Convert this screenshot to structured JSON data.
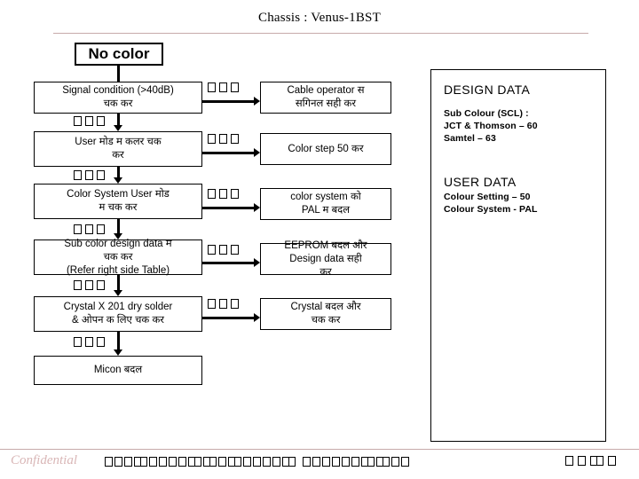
{
  "slide": {
    "title": "Chassis : Venus-1BST",
    "accent_rule_color": "#c7aaaa"
  },
  "flow": {
    "header_box": {
      "label": "No color"
    },
    "left_column": [
      {
        "id": "signal",
        "lines": [
          "Signal condition (>40dB)",
          "चक   कर"
        ]
      },
      {
        "id": "usermode",
        "lines": [
          "User मोड   म     कलर चक",
          "कर"
        ]
      },
      {
        "id": "colorsys",
        "lines": [
          "Color System  User मोड",
          "म     चक   कर"
        ]
      },
      {
        "id": "subcolor",
        "lines": [
          "Sub color design data म",
          "चक   कर",
          "(Refer right side Table)"
        ]
      },
      {
        "id": "crystal",
        "lines": [
          "Crystal  X 201   dry solder",
          "& ओपन  क   लिए   चक   कर"
        ]
      },
      {
        "id": "micon",
        "lines": [
          "Micon  बदल"
        ]
      }
    ],
    "right_column": [
      {
        "id": "cable",
        "lines": [
          "Cable operator स",
          "सगिनल    सही   कर"
        ]
      },
      {
        "id": "colorstep",
        "lines": [
          "Color step  50 कर"
        ]
      },
      {
        "id": "palchange",
        "lines": [
          "color system को",
          "PAL म     बदल"
        ]
      },
      {
        "id": "eeprom",
        "lines": [
          "EEPROM  बदल   और",
          "Design data सही",
          "कर"
        ]
      },
      {
        "id": "crystalchg",
        "lines": [
          "Crystal बदल   और",
          "चक   कर"
        ]
      }
    ]
  },
  "data_panel": {
    "design_heading": "DESIGN DATA",
    "design_lines": [
      "Sub Colour (SCL) :",
      "JCT & Thomson – 60",
      "Samtel – 63"
    ],
    "user_heading": "USER DATA",
    "user_lines": [
      "Colour Setting – 50",
      "Colour System - PAL"
    ]
  },
  "footer": {
    "confidential": "Confidential"
  }
}
